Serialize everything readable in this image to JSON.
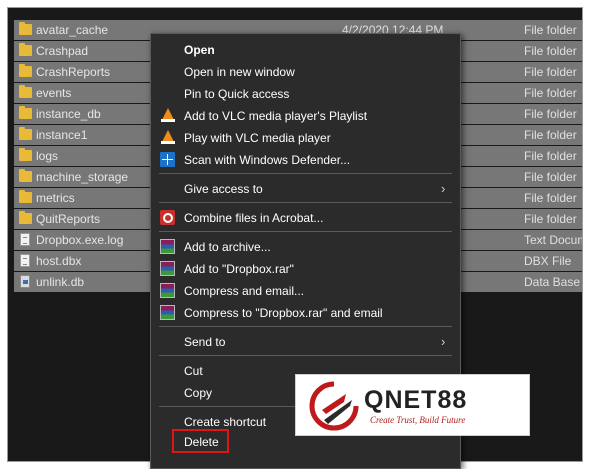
{
  "files": [
    {
      "name": "avatar_cache",
      "date": "4/2/2020 12:44 PM",
      "type": "File folder",
      "icon": "folder-icon"
    },
    {
      "name": "Crashpad",
      "date": "",
      "type": "File folder",
      "icon": "folder-icon"
    },
    {
      "name": "CrashReports",
      "date": "",
      "type": "File folder",
      "icon": "folder-icon"
    },
    {
      "name": "events",
      "date": "",
      "type": "File folder",
      "icon": "folder-icon"
    },
    {
      "name": "instance_db",
      "date": "",
      "type": "File folder",
      "icon": "folder-icon"
    },
    {
      "name": "instance1",
      "date": "",
      "type": "File folder",
      "icon": "folder-icon"
    },
    {
      "name": "logs",
      "date": "",
      "type": "File folder",
      "icon": "folder-icon"
    },
    {
      "name": "machine_storage",
      "date": "",
      "type": "File folder",
      "icon": "folder-icon"
    },
    {
      "name": "metrics",
      "date": "",
      "type": "File folder",
      "icon": "folder-icon"
    },
    {
      "name": "QuitReports",
      "date": "",
      "type": "File folder",
      "icon": "folder-icon"
    },
    {
      "name": "Dropbox.exe.log",
      "date": "",
      "type": "Text Docum",
      "icon": "text-file-icon"
    },
    {
      "name": "host.dbx",
      "date": "",
      "type": "DBX File",
      "icon": "file-icon"
    },
    {
      "name": "unlink.db",
      "date": "",
      "type": "Data Base",
      "icon": "database-file-icon"
    }
  ],
  "context_menu": {
    "open": "Open",
    "open_new_window": "Open in new window",
    "pin_quick_access": "Pin to Quick access",
    "add_vlc_playlist": "Add to VLC media player's Playlist",
    "play_vlc": "Play with VLC media player",
    "scan_defender": "Scan with Windows Defender...",
    "give_access": "Give access to",
    "combine_acrobat": "Combine files in Acrobat...",
    "add_archive": "Add to archive...",
    "add_dropbox_rar": "Add to \"Dropbox.rar\"",
    "compress_email": "Compress and email...",
    "compress_dropbox_rar_email": "Compress to \"Dropbox.rar\" and email",
    "send_to": "Send to",
    "cut": "Cut",
    "copy": "Copy",
    "create_shortcut": "Create shortcut",
    "delete": "Delete"
  },
  "watermark": {
    "brand": "QNET88",
    "tagline": "Create Trust, Build Future"
  },
  "colors": {
    "background": "#191919",
    "selection": "#777777",
    "menu_bg": "#2b2b2b",
    "highlight_border": "#e01515",
    "folder": "#e9b938"
  }
}
